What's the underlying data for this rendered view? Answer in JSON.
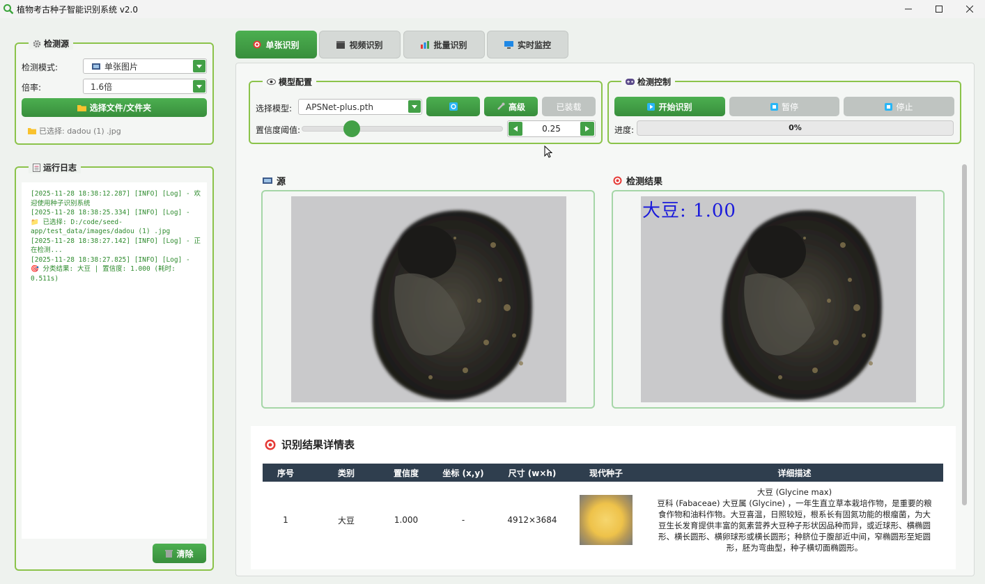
{
  "window": {
    "title": "植物考古种子智能识别系统 v2.0"
  },
  "source_group": {
    "title": "检测源",
    "mode_label": "检测模式:",
    "mode_value": "单张图片",
    "rate_label": "倍率:",
    "rate_value": "1.6倍",
    "select_button": "选择文件/文件夹",
    "selected_text": "已选择: dadou (1) .jpg"
  },
  "log_group": {
    "title": "运行日志",
    "lines": [
      "[2025-11-28 18:38:12.287] [INFO] [Log] - 欢迎使用种子识别系统",
      "[2025-11-28 18:38:25.334] [INFO] [Log] - 📁 已选择: D:/code/seed-app/test_data/images/dadou (1) .jpg",
      "[2025-11-28 18:38:27.142] [INFO] [Log] - 正在检测...",
      "[2025-11-28 18:38:27.825] [INFO] [Log] - 🎯 分类结果: 大豆 | 置信度: 1.000 (耗时: 0.511s)"
    ],
    "clear_button": "清除"
  },
  "tabs": [
    "单张识别",
    "视频识别",
    "批量识别",
    "实时监控"
  ],
  "model_group": {
    "title": "模型配置",
    "model_label": "选择模型:",
    "model_value": "APSNet-plus.pth",
    "advanced_button": "高级",
    "loaded_button": "已装载",
    "threshold_label": "置信度阈值:",
    "threshold_value": "0.25",
    "threshold_fraction": 0.25
  },
  "control_group": {
    "title": "检测控制",
    "start_button": "开始识别",
    "pause_button": "暂停",
    "stop_button": "停止",
    "progress_label": "进度:",
    "progress_text": "0%",
    "progress_value": 0
  },
  "source_panel": {
    "label": "源"
  },
  "result_panel": {
    "label": "检测结果",
    "overlay": "大豆: 1.00"
  },
  "results_table": {
    "title": "识别结果详情表",
    "headers": [
      "序号",
      "类别",
      "置信度",
      "坐标 (x,y)",
      "尺寸 (w×h)",
      "现代种子",
      "详细描述"
    ],
    "rows": [
      {
        "index": "1",
        "category": "大豆",
        "confidence": "1.000",
        "coords": "-",
        "size": "4912×3684",
        "desc_title": "大豆 (Glycine max)",
        "desc_body": "豆科 (Fabaceae) 大豆属 (Glycine) ，一年生直立草本栽培作物，是重要的粮食作物和油料作物。大豆喜温，日照较短，根系长有固氮功能的根瘤菌，为大豆生长发育提供丰富的氮素营养大豆种子形状因品种而异，或近球形、横椭圆形、横长圆形、横卵球形或横长圆形；种脐位于腹部近中间，窄椭圆形至矩圆形，胚为弯曲型，种子横切面椭圆形。"
      }
    ]
  },
  "colors": {
    "accent": "#43a047",
    "border": "#8bc34a",
    "header": "#2f3e4e",
    "log_text": "#2e8b2e"
  }
}
